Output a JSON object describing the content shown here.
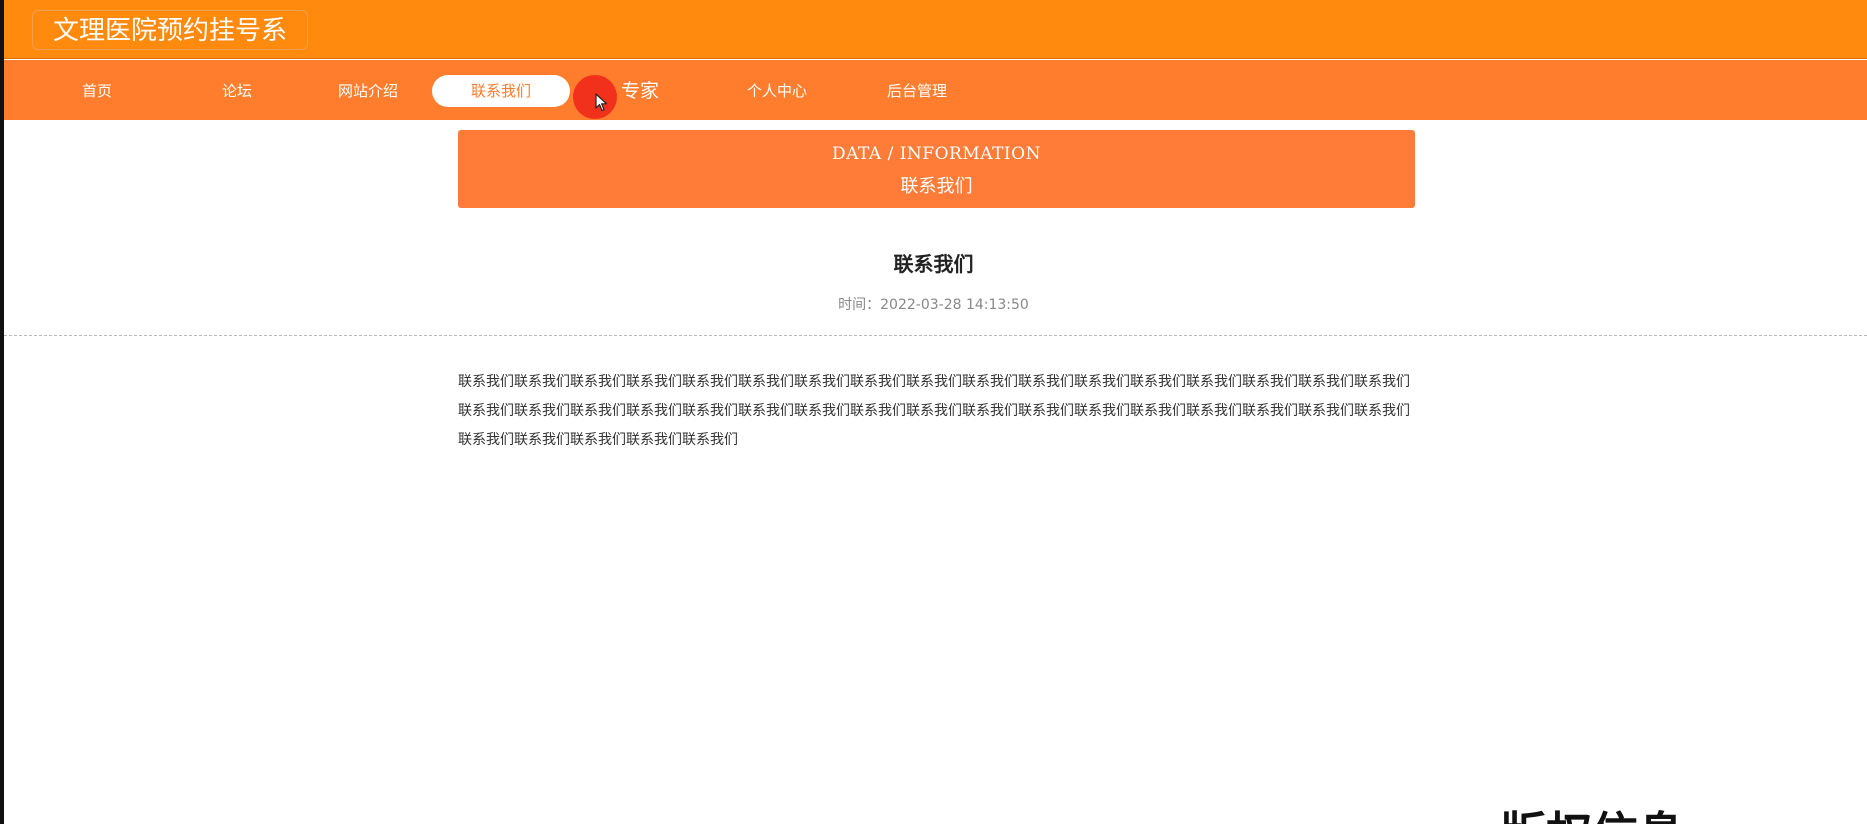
{
  "header": {
    "site_title": "文理医院预约挂号系"
  },
  "nav": {
    "items": [
      {
        "label": "首页",
        "active": false
      },
      {
        "label": "论坛",
        "active": false
      },
      {
        "label": "网站介绍",
        "active": false
      },
      {
        "label": "联系我们",
        "active": true
      },
      {
        "label": "专家",
        "active": false
      },
      {
        "label": "个人中心",
        "active": false
      },
      {
        "label": "后台管理",
        "active": false
      }
    ]
  },
  "banner": {
    "en": "DATA / INFORMATION",
    "zh": "联系我们"
  },
  "article": {
    "title": "联系我们",
    "time_label": "时间：",
    "time_value": "2022-03-28 14:13:50",
    "body": "联系我们联系我们联系我们联系我们联系我们联系我们联系我们联系我们联系我们联系我们联系我们联系我们联系我们联系我们联系我们联系我们联系我们联系我们联系我们联系我们联系我们联系我们联系我们联系我们联系我们联系我们联系我们联系我们联系我们联系我们联系我们联系我们联系我们联系我们联系我们联系我们联系我们联系我们联系我们"
  },
  "overlay": {
    "corner_text": "版权信息"
  },
  "colors": {
    "header_bg": "#ff8a0e",
    "nav_bg": "#ff7d2d",
    "banner_bg": "#ff7c38",
    "cursor_highlight": "#f02a1a"
  }
}
